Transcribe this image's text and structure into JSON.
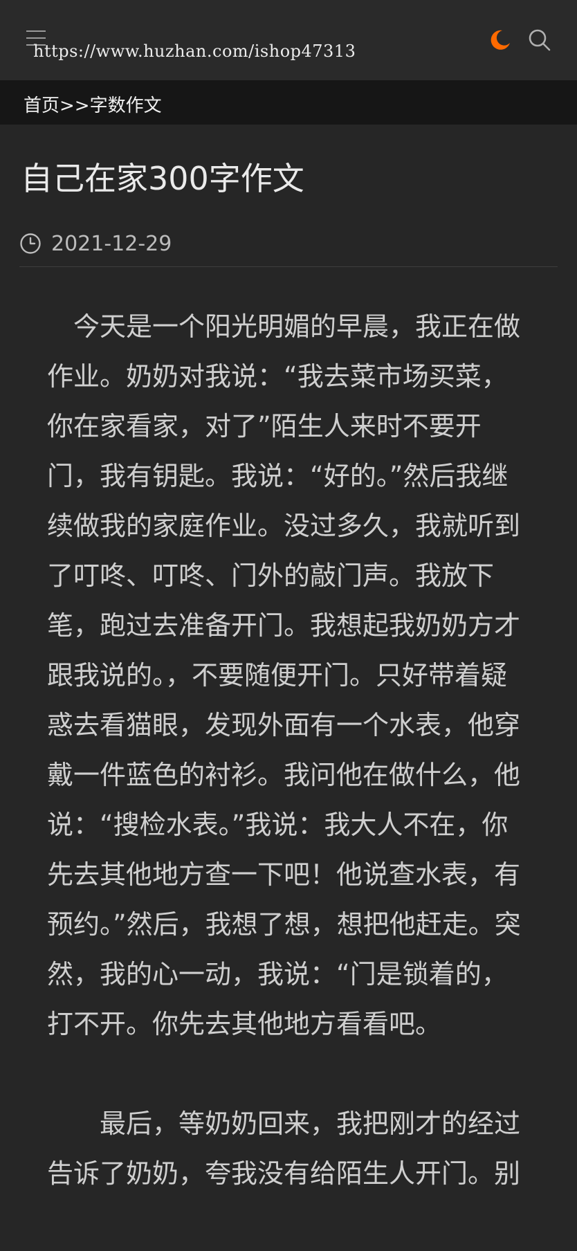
{
  "header": {
    "menu_icon": "hamburger-menu-icon",
    "watermark": "https://www.huzhan.com/ishop47313",
    "theme_icon": "moon-icon",
    "theme_color": "#ff6a00",
    "search_icon": "search-icon"
  },
  "breadcrumb": {
    "home": "首页",
    "separator": ">>",
    "category": "字数作文"
  },
  "article": {
    "title": "自己在家300字作文",
    "date": "2021-12-29",
    "paragraphs": [
      "今天是一个阳光明媚的早晨，我正在做作业。奶奶对我说：“我去菜市场买菜，你在家看家，对了”陌生人来时不要开门，我有钥匙。我说：“好的。”然后我继续做我的家庭作业。没过多久，我就听到了叮咚、叮咚、门外的敲门声。我放下笔，跑过去准备开门。我想起我奶奶方才跟我说的。，不要随便开门。只好带着疑惑去看猫眼，发现外面有一个水表，他穿戴一件蓝色的衬衫。我问他在做什么，他说：“搜检水表。”我说：我大人不在，你先去其他地方查一下吧！他说查水表，有预约。”然后，我想了想，想把他赶走。突然，我的心一动，我说：“门是锁着的，打不开。你先去其他地方看看吧。",
      "最后，等奶奶回来，我把刚才的经过告诉了奶奶，夸我没有给陌生人开门。别"
    ]
  }
}
